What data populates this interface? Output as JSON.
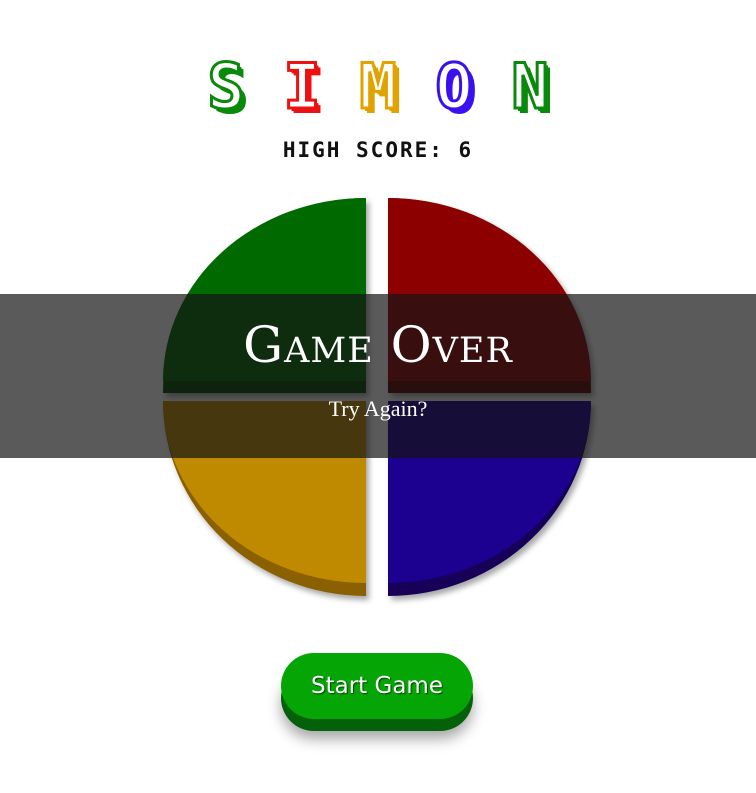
{
  "game": {
    "title_letters": [
      {
        "char": "S",
        "color": "#0a8a0a"
      },
      {
        "char": "I",
        "color": "#ee1111"
      },
      {
        "char": "M",
        "color": "#e0a300"
      },
      {
        "char": "O",
        "color": "#3a10ee"
      },
      {
        "char": "N",
        "color": "#0a8a0a"
      }
    ],
    "high_score_label": "HIGH SCORE: 6",
    "high_score": 6
  },
  "board": {
    "colors": {
      "green": "#036a03",
      "green_dark": "#024602",
      "red": "#8c0000",
      "red_dark": "#5a0000",
      "yellow": "#c08a00",
      "yellow_dark": "#8a6000",
      "blue": "#1e0090",
      "blue_dark": "#120058"
    }
  },
  "overlay": {
    "title": "Game Over",
    "subtitle": "Try Again?"
  },
  "controls": {
    "start_label": "Start Game",
    "start_color": "#04a504"
  }
}
